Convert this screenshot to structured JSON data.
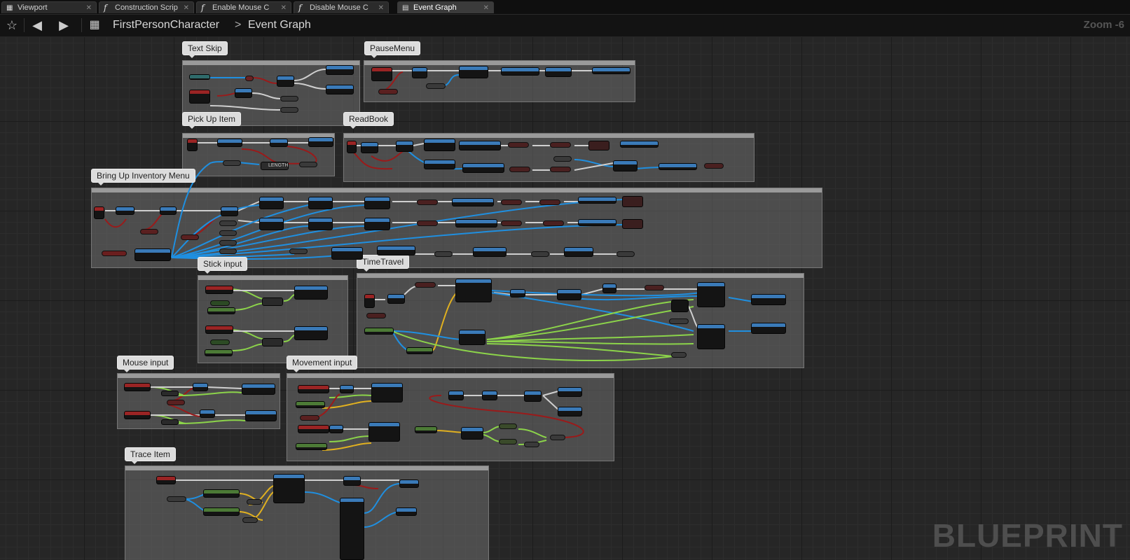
{
  "tabs": [
    {
      "label": "Viewport",
      "icon": "viewport-icon",
      "active": false
    },
    {
      "label": "Construction Scrip",
      "icon": "function-icon",
      "active": false
    },
    {
      "label": "Enable Mouse C",
      "icon": "function-icon",
      "active": false
    },
    {
      "label": "Disable Mouse C",
      "icon": "function-icon",
      "active": false
    },
    {
      "label": "Event Graph",
      "icon": "graph-icon",
      "active": true
    }
  ],
  "toolbar": {
    "favorite_icon": "star-icon",
    "back_icon": "back-arrow-icon",
    "forward_icon": "forward-arrow-icon",
    "blueprint_icon": "grid-icon"
  },
  "breadcrumb": {
    "root": "FirstPersonCharacter",
    "separator": ">",
    "current": "Event Graph"
  },
  "zoom": "Zoom -6",
  "watermark": "BLUEPRINT",
  "comments": [
    {
      "title": "Text Skip"
    },
    {
      "title": "PauseMenu"
    },
    {
      "title": "Pick Up Item"
    },
    {
      "title": "ReadBook"
    },
    {
      "title": "Bring Up Inventory Menu"
    },
    {
      "title": "Stick input"
    },
    {
      "title": "TimeTravel"
    },
    {
      "title": "Mouse input"
    },
    {
      "title": "Movement input"
    },
    {
      "title": "Trace Item"
    }
  ],
  "node_labels": {
    "length": "LENGTH"
  },
  "colors": {
    "exec": "#cfcfcf",
    "object": "#1f8fe0",
    "bool": "#9a1a1a",
    "float": "#8cd44a",
    "vector": "#e0b020",
    "tab_active": "#3b3b3b"
  }
}
